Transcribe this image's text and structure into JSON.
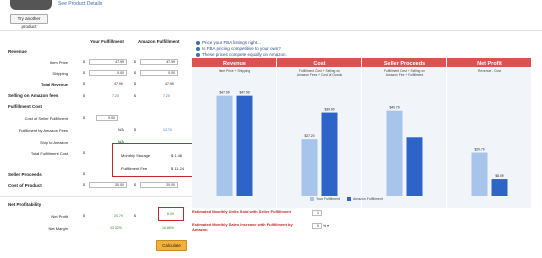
{
  "top": {
    "see_details": "See Product Details",
    "try_button": "Try another product"
  },
  "table": {
    "col_your": "Your Fulfillment",
    "col_amazon": "Amazon Fulfillment",
    "revenue": "Revenue",
    "item_price": "Item Price",
    "shipping": "Shipping",
    "total_revenue": "Total Revenue",
    "selling_fees": "Selling on Amazon fees",
    "fulfillment_cost": "Fulfillment Cost",
    "cost_seller": "Cost of Seller Fulfillment",
    "fba_fees": "Fulfillment by Amazon Fees",
    "ship_to_amazon": "Ship to Amazon",
    "total_fulfillment": "Total Fulfillment Cost",
    "seller_proceeds": "Seller Proceeds",
    "cost_of_product": "Cost of Product",
    "net_profitability": "Net Profitability",
    "net_profit": "Net Profit",
    "net_margin": "Net Margin",
    "currency": "$",
    "your": {
      "item_price": "47.99",
      "shipping": "0.00",
      "total_revenue": "47.99",
      "selling_fees": "7.20",
      "cost_seller": "0.00",
      "fba_fees": "N/A",
      "ship_to_amazon": "N/A",
      "total_fulfillment": "0",
      "seller_proceeds": "",
      "cost_of_product": "20.00",
      "net_profit": "20.79",
      "net_margin": "43.32%"
    },
    "amazon": {
      "item_price": "47.99",
      "shipping": "0.00",
      "total_revenue": "47.99",
      "selling_fees": "7.20",
      "cost_seller": "",
      "fba_fees": "12.70",
      "ship_to_amazon": "",
      "total_fulfillment": "",
      "seller_proceeds": "",
      "cost_of_product": "20.00",
      "net_profit": "8.09",
      "net_margin": "16.86%"
    }
  },
  "popup": {
    "monthly_storage_label": "Monthly Storage",
    "monthly_storage_value": "$ 1.46",
    "fulfillment_fee_label": "Fulfillment Fee",
    "fulfillment_fee_value": "$ 11.24"
  },
  "calc_button": "Calculate",
  "bullets": [
    "Price your FBA listings right...",
    "Is FBA pricing competitive to your own?",
    "These prices compete equally on Amazon.",
    "Have you accounted for all of your costs?"
  ],
  "chart": {
    "columns": [
      {
        "title": "Revenue",
        "subtitle": "Item Price + Shipping",
        "color": "#d9534f"
      },
      {
        "title": "Cost",
        "subtitle": "Fulfillment Cost + Selling on Amazon Fees + Cost of Goods",
        "color": "#d9534f"
      },
      {
        "title": "Seller Proceeds",
        "subtitle": "Fulfillment Cost + Selling on Amazon Fee + Fulfillment",
        "color": "#d9534f"
      },
      {
        "title": "Net Profit",
        "subtitle": "Revenue - Cost",
        "color": "#d9534f"
      }
    ],
    "legend": {
      "your": "Your Fulfillment",
      "amazon": "Amazon Fulfillment"
    },
    "colors": {
      "your": "#a7c4ea",
      "amazon": "#2e63c8",
      "header": "#d9534f"
    }
  },
  "chart_data": {
    "type": "bar",
    "categories": [
      "Revenue",
      "Cost",
      "Seller Proceeds",
      "Net Profit"
    ],
    "series": [
      {
        "name": "Your Fulfillment",
        "values": [
          47.99,
          27.2,
          40.79,
          20.79
        ]
      },
      {
        "name": "Amazon Fulfillment",
        "values": [
          47.99,
          39.9,
          28.09,
          8.09
        ]
      }
    ],
    "labels": {
      "Your Fulfillment": [
        "$47.99",
        "$27.20",
        "$40.79",
        "$20.79"
      ],
      "Amazon Fulfillment": [
        "$47.99",
        "$39.90",
        "",
        "$8.09"
      ]
    }
  },
  "bottom": {
    "units_sold_q": "Estimated Monthly Units Sold with Seller Fulfillment",
    "sales_increase_q": "Estimated Monthly Sales Increase with Fulfillment by Amazon",
    "units_value": "1",
    "increase_value": "0",
    "percent": "%"
  }
}
